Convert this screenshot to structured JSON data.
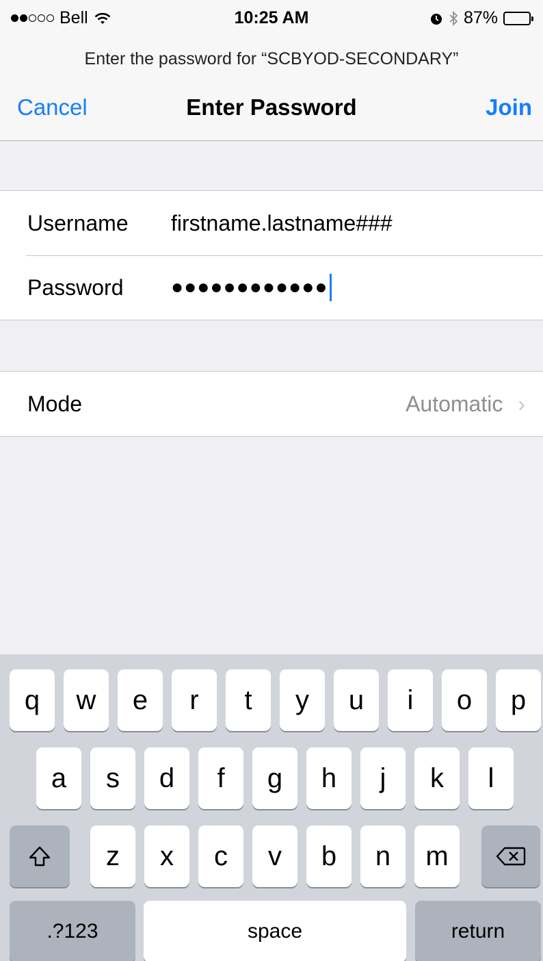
{
  "status_bar": {
    "carrier": "Bell",
    "signal_strength": 2,
    "signal_total": 5,
    "time": "10:25 AM",
    "battery_percent": "87%",
    "battery_level": 0.87
  },
  "prompt": "Enter the password for “SCBYOD-SECONDARY”",
  "nav": {
    "cancel_label": "Cancel",
    "title": "Enter Password",
    "join_label": "Join"
  },
  "credentials": {
    "username_label": "Username",
    "username_value": "firstname.lastname###",
    "password_label": "Password",
    "password_masked": "●●●●●●●●●●●●"
  },
  "mode": {
    "label": "Mode",
    "value": "Automatic"
  },
  "keyboard": {
    "row1": [
      "q",
      "w",
      "e",
      "r",
      "t",
      "y",
      "u",
      "i",
      "o",
      "p"
    ],
    "row2": [
      "a",
      "s",
      "d",
      "f",
      "g",
      "h",
      "j",
      "k",
      "l"
    ],
    "row3": [
      "z",
      "x",
      "c",
      "v",
      "b",
      "n",
      "m"
    ],
    "numbers_label": ".?123",
    "space_label": "space",
    "return_label": "return"
  },
  "colors": {
    "accent": "#157efb",
    "keyboard_bg": "#d1d5db",
    "special_key": "#adb3bc"
  }
}
